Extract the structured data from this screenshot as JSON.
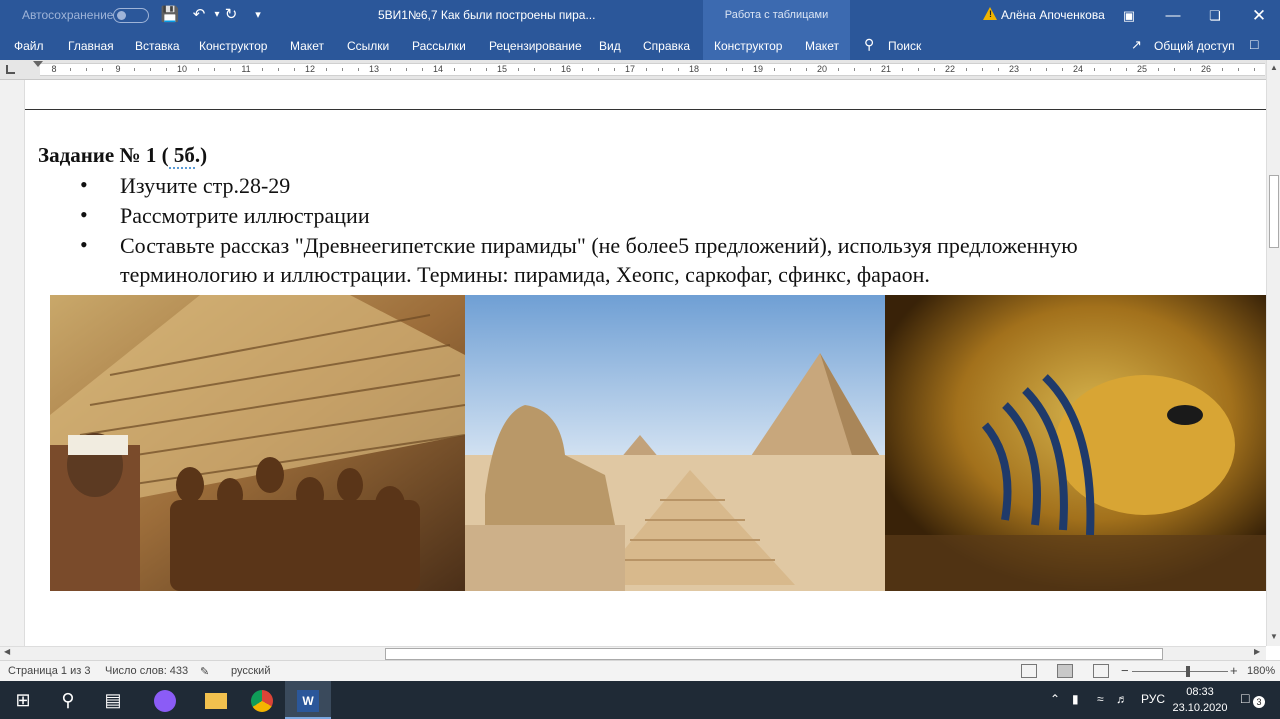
{
  "titlebar": {
    "autosave_label": "Автосохранение",
    "document_title": "5ВИ1№6,7 Как были построены пира...",
    "context_label": "Работа с таблицами",
    "user_name": "Алёна Апоченкова"
  },
  "ribbon": {
    "tabs": [
      "Файл",
      "Главная",
      "Вставка",
      "Конструктор",
      "Макет",
      "Ссылки",
      "Рассылки",
      "Рецензирование",
      "Вид",
      "Справка",
      "Конструктор",
      "Макет"
    ],
    "search_label": "Поиск",
    "share_label": "Общий доступ"
  },
  "ruler": {
    "numbers": [
      "8",
      "9",
      "10",
      "11",
      "12",
      "13",
      "14",
      "15",
      "16",
      "17",
      "18",
      "19",
      "20",
      "21",
      "22",
      "23",
      "24",
      "25",
      "26"
    ]
  },
  "document": {
    "heading_pre": "Задание № 1 (",
    "heading_squiggle": " 5б",
    "heading_post": ".)",
    "bullet_char": "•",
    "bullets": [
      "Изучите стр.28-29",
      "Рассмотрите иллюстрации",
      "Составьте рассказ \"Древнеегипетские пирамиды\" (не более5 предложений), используя предложенную",
      "терминологию и иллюстрации. Термины: пирамида, Хеопс, саркофаг, сфинкс, фараон."
    ]
  },
  "statusbar": {
    "page": "Страница 1 из 3",
    "words": "Число слов: 433",
    "language": "русский",
    "zoom": "180%"
  },
  "taskbar": {
    "lang": "РУС",
    "time": "08:33",
    "date": "23.10.2020",
    "notification_count": "3"
  },
  "colors": {
    "word_blue": "#2b579a",
    "context_tab": "#3c6ab0"
  }
}
